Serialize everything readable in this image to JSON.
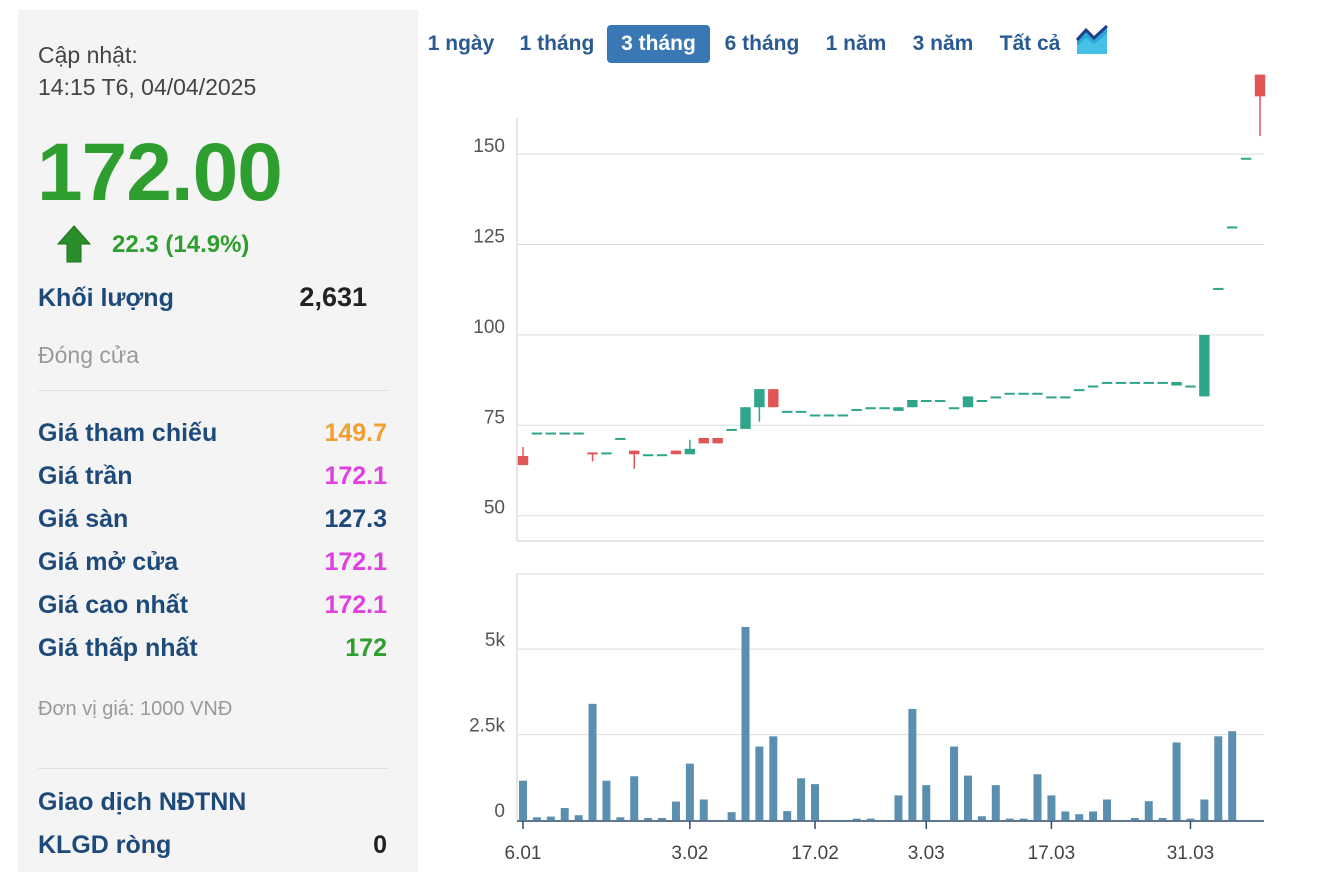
{
  "sidebar": {
    "update_label": "Cập nhật:",
    "update_time": "14:15 T6, 04/04/2025",
    "price": "172.00",
    "change": "22.3 (14.9%)",
    "volume_label": "Khối lượng",
    "volume_value": "2,631",
    "status": "Đóng cửa",
    "rows": [
      {
        "label": "Giá tham chiếu",
        "value": "149.7",
        "color": "#f0a030"
      },
      {
        "label": "Giá trần",
        "value": "172.1",
        "color": "#e040e0"
      },
      {
        "label": "Giá sàn",
        "value": "127.3",
        "color": "#1d4a7a"
      },
      {
        "label": "Giá mở cửa",
        "value": "172.1",
        "color": "#e040e0"
      },
      {
        "label": "Giá cao nhất",
        "value": "172.1",
        "color": "#e040e0"
      },
      {
        "label": "Giá thấp nhất",
        "value": "172",
        "color": "#2e9e2e"
      }
    ],
    "unit_note": "Đơn vị giá: 1000 VNĐ",
    "foreign_label": "Giao dịch NĐTNN",
    "net_label": "KLGD ròng",
    "net_value": "0"
  },
  "tabs": [
    {
      "label": "1 ngày",
      "active": false
    },
    {
      "label": "1 tháng",
      "active": false
    },
    {
      "label": "3 tháng",
      "active": true
    },
    {
      "label": "6 tháng",
      "active": false
    },
    {
      "label": "1 năm",
      "active": false
    },
    {
      "label": "3 năm",
      "active": false
    },
    {
      "label": "Tất cả",
      "active": false
    }
  ],
  "icons": {
    "arrow": "up-arrow-icon",
    "chart_type": "area-chart-icon"
  },
  "colors": {
    "up": "#2fa58a",
    "down": "#e05555",
    "volume": "#5b8fb0",
    "accent": "#3a77b5"
  },
  "chart_data": [
    {
      "type": "candlestick",
      "title": "",
      "ylim": [
        43,
        160
      ],
      "yticks": [
        50,
        75,
        100,
        125,
        150
      ],
      "xtick_labels": [
        "6.01",
        "3.02",
        "17.02",
        "3.03",
        "17.03",
        "31.03"
      ],
      "xtick_index": [
        0,
        12,
        21,
        29,
        38,
        48
      ],
      "candles": [
        {
          "o": 66.5,
          "h": 69,
          "l": 64,
          "c": 64
        },
        {
          "o": 73,
          "h": 73,
          "l": 73,
          "c": 73
        },
        {
          "o": 73,
          "h": 73,
          "l": 73,
          "c": 73
        },
        {
          "o": 73,
          "h": 73,
          "l": 73,
          "c": 73
        },
        {
          "o": 73,
          "h": 73,
          "l": 73,
          "c": 73
        },
        {
          "o": 67.5,
          "h": 67.5,
          "l": 65,
          "c": 67
        },
        {
          "o": 67.5,
          "h": 67.5,
          "l": 67.5,
          "c": 67.5
        },
        {
          "o": 71.5,
          "h": 71.5,
          "l": 71.5,
          "c": 71.5
        },
        {
          "o": 68,
          "h": 68,
          "l": 63,
          "c": 67
        },
        {
          "o": 67,
          "h": 67,
          "l": 67,
          "c": 67
        },
        {
          "o": 67,
          "h": 67,
          "l": 67,
          "c": 67
        },
        {
          "o": 68,
          "h": 68,
          "l": 67,
          "c": 67
        },
        {
          "o": 67,
          "h": 71,
          "l": 67,
          "c": 68.5
        },
        {
          "o": 71.5,
          "h": 71.5,
          "l": 70,
          "c": 70
        },
        {
          "o": 71.5,
          "h": 71.5,
          "l": 70,
          "c": 70
        },
        {
          "o": 74,
          "h": 74,
          "l": 74,
          "c": 74
        },
        {
          "o": 74,
          "h": 80,
          "l": 74,
          "c": 80
        },
        {
          "o": 80,
          "h": 85,
          "l": 76,
          "c": 85
        },
        {
          "o": 85,
          "h": 85,
          "l": 80,
          "c": 80
        },
        {
          "o": 79,
          "h": 79,
          "l": 79,
          "c": 79
        },
        {
          "o": 79,
          "h": 79,
          "l": 79,
          "c": 79
        },
        {
          "o": 78,
          "h": 78,
          "l": 78,
          "c": 78
        },
        {
          "o": 78,
          "h": 78,
          "l": 78,
          "c": 78
        },
        {
          "o": 78,
          "h": 78,
          "l": 78,
          "c": 78
        },
        {
          "o": 79.5,
          "h": 79.5,
          "l": 79.5,
          "c": 79.5
        },
        {
          "o": 80,
          "h": 80,
          "l": 80,
          "c": 80
        },
        {
          "o": 80,
          "h": 80,
          "l": 80,
          "c": 80
        },
        {
          "o": 79,
          "h": 80,
          "l": 79,
          "c": 80
        },
        {
          "o": 80,
          "h": 82,
          "l": 80,
          "c": 82
        },
        {
          "o": 82,
          "h": 82,
          "l": 82,
          "c": 82
        },
        {
          "o": 82,
          "h": 82,
          "l": 82,
          "c": 82
        },
        {
          "o": 80,
          "h": 80,
          "l": 80,
          "c": 80
        },
        {
          "o": 80,
          "h": 83,
          "l": 80,
          "c": 83
        },
        {
          "o": 82,
          "h": 82,
          "l": 82,
          "c": 82
        },
        {
          "o": 83,
          "h": 83,
          "l": 83,
          "c": 83
        },
        {
          "o": 84,
          "h": 84,
          "l": 84,
          "c": 84
        },
        {
          "o": 84,
          "h": 84,
          "l": 84,
          "c": 84
        },
        {
          "o": 84,
          "h": 84,
          "l": 84,
          "c": 84
        },
        {
          "o": 83,
          "h": 83,
          "l": 83,
          "c": 83
        },
        {
          "o": 83,
          "h": 83,
          "l": 83,
          "c": 83
        },
        {
          "o": 85,
          "h": 85,
          "l": 85,
          "c": 85
        },
        {
          "o": 86,
          "h": 86,
          "l": 86,
          "c": 86
        },
        {
          "o": 87,
          "h": 87,
          "l": 87,
          "c": 87
        },
        {
          "o": 87,
          "h": 87,
          "l": 87,
          "c": 87
        },
        {
          "o": 87,
          "h": 87,
          "l": 87,
          "c": 87
        },
        {
          "o": 87,
          "h": 87,
          "l": 87,
          "c": 87
        },
        {
          "o": 87,
          "h": 87,
          "l": 87,
          "c": 87
        },
        {
          "o": 86,
          "h": 87,
          "l": 86,
          "c": 87
        },
        {
          "o": 86,
          "h": 86,
          "l": 86,
          "c": 86
        },
        {
          "o": 83,
          "h": 100,
          "l": 83,
          "c": 100
        },
        {
          "o": 113,
          "h": 113,
          "l": 113,
          "c": 113
        },
        {
          "o": 130,
          "h": 130,
          "l": 130,
          "c": 130
        },
        {
          "o": 149,
          "h": 149,
          "l": 149,
          "c": 149
        },
        {
          "o": 172,
          "h": 172,
          "l": 155,
          "c": 166
        }
      ]
    },
    {
      "type": "bar",
      "title": "",
      "ylim": [
        0,
        7200
      ],
      "yticks": [
        0,
        2500,
        5000
      ],
      "ytick_labels": [
        "0",
        "2.5k",
        "5k"
      ],
      "values": [
        1150,
        80,
        100,
        350,
        140,
        3400,
        1150,
        80,
        1280,
        60,
        60,
        540,
        1650,
        600,
        0,
        230,
        5650,
        2150,
        2450,
        260,
        1220,
        1050,
        0,
        0,
        40,
        40,
        0,
        720,
        3250,
        1020,
        0,
        2150,
        1300,
        110,
        1020,
        40,
        40,
        1340,
        720,
        250,
        170,
        250,
        600,
        0,
        60,
        550,
        60,
        2270,
        40,
        600,
        2450,
        2600
      ]
    }
  ]
}
